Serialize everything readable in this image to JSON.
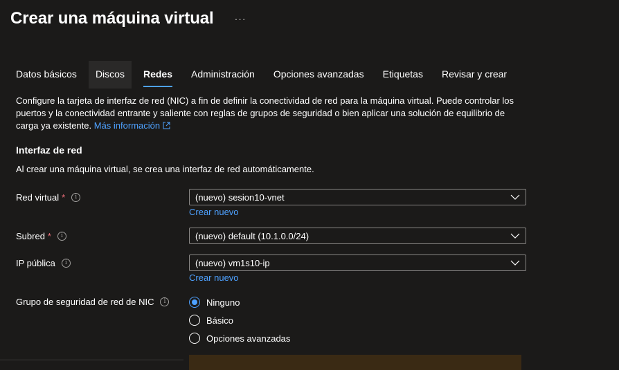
{
  "header": {
    "title": "Crear una máquina virtual",
    "more": "···"
  },
  "tabs": [
    {
      "label": "Datos básicos"
    },
    {
      "label": "Discos"
    },
    {
      "label": "Redes"
    },
    {
      "label": "Administración"
    },
    {
      "label": "Opciones avanzadas"
    },
    {
      "label": "Etiquetas"
    },
    {
      "label": "Revisar y crear"
    }
  ],
  "active_tab": "Redes",
  "description": {
    "text": "Configure la tarjeta de interfaz de red (NIC) a fin de definir la conectividad de red para la máquina virtual. Puede controlar los puertos y la conectividad entrante y saliente con reglas de grupos de seguridad o bien aplicar una solución de equilibrio de carga ya existente.",
    "link": "Más información"
  },
  "section": {
    "title": "Interfaz de red",
    "subtitle": "Al crear una máquina virtual, se crea una interfaz de red automáticamente."
  },
  "fields": {
    "virtual_network": {
      "label": "Red virtual",
      "required": "*",
      "value": "(nuevo) sesion10-vnet",
      "create_link": "Crear nuevo"
    },
    "subnet": {
      "label": "Subred",
      "required": "*",
      "value": "(nuevo) default (10.1.0.0/24)"
    },
    "public_ip": {
      "label": "IP pública",
      "value": "(nuevo) vm1s10-ip",
      "create_link": "Crear nuevo"
    },
    "nsg": {
      "label": "Grupo de seguridad de red de NIC",
      "options": [
        "Ninguno",
        "Básico",
        "Opciones avanzadas"
      ],
      "selected": "Ninguno"
    }
  },
  "colors": {
    "background": "#1b1a19",
    "accent": "#4ea1ff",
    "required": "#f1707b",
    "border": "#8a8886"
  },
  "icons": {
    "info": "i",
    "chevron": "chevron-down-icon",
    "external": "external-link-icon"
  }
}
